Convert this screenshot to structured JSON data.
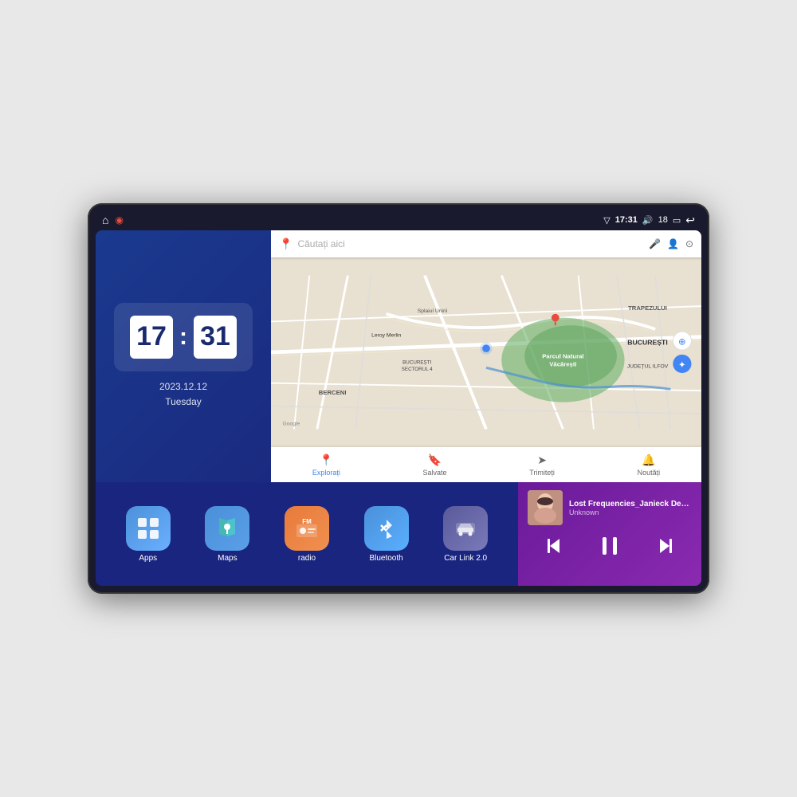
{
  "device": {
    "screen_bg": "#1a2a6e"
  },
  "status_bar": {
    "left_icons": [
      "⌂",
      "◉"
    ],
    "time": "17:31",
    "signal_icon": "▽",
    "volume_icon": "🔊",
    "volume_level": "18",
    "battery_icon": "▭",
    "back_icon": "↩"
  },
  "clock": {
    "hour": "17",
    "minute": "31",
    "date": "2023.12.12",
    "day": "Tuesday"
  },
  "map": {
    "search_placeholder": "Căutați aici",
    "nav_items": [
      {
        "label": "Explorați",
        "icon": "📍"
      },
      {
        "label": "Salvate",
        "icon": "🔖"
      },
      {
        "label": "Trimiteți",
        "icon": "➤"
      },
      {
        "label": "Noutăți",
        "icon": "🔔"
      }
    ],
    "locations": [
      "TRAPEZULUI",
      "BUCUREȘTI",
      "JUDEȚUL ILFOV",
      "BERCENI",
      "Parcul Natural Văcărești",
      "Leroy Merlin",
      "BUCUREȘTI SECTORUL 4",
      "Splaiul Unirii"
    ]
  },
  "apps": [
    {
      "id": "apps",
      "label": "Apps",
      "icon": "⊞",
      "color_class": "app-icon-apps"
    },
    {
      "id": "maps",
      "label": "Maps",
      "icon": "📍",
      "color_class": "app-icon-maps"
    },
    {
      "id": "radio",
      "label": "radio",
      "icon": "📻",
      "color_class": "app-icon-radio"
    },
    {
      "id": "bluetooth",
      "label": "Bluetooth",
      "icon": "🔵",
      "color_class": "app-icon-bluetooth"
    },
    {
      "id": "carlink",
      "label": "Car Link 2.0",
      "icon": "🚗",
      "color_class": "app-icon-carlink"
    }
  ],
  "music": {
    "title": "Lost Frequencies_Janieck Devy-...",
    "artist": "Unknown",
    "thumb_emoji": "🎵",
    "controls": {
      "prev": "⏮",
      "play": "⏸",
      "next": "⏭"
    }
  }
}
